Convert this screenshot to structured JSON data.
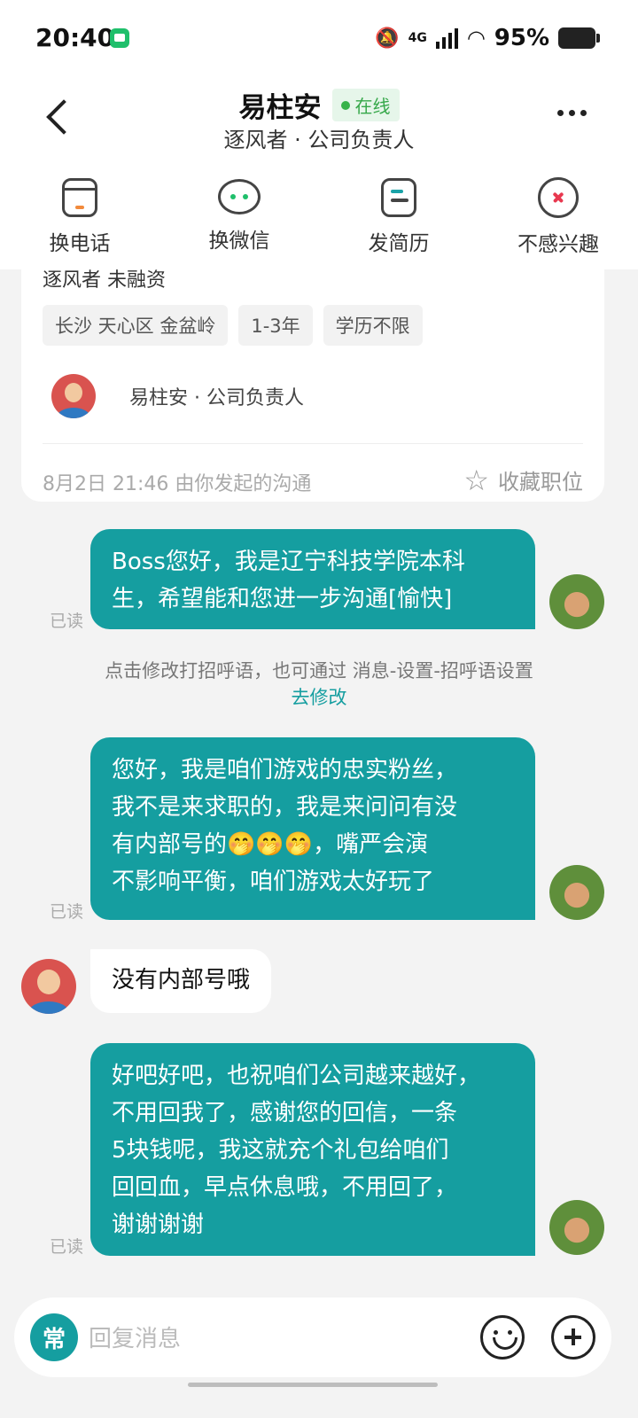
{
  "status_bar": {
    "time": "20:40",
    "battery_pct": "95%",
    "network": "4G"
  },
  "header": {
    "name": "易柱安",
    "online_label": "在线",
    "subtitle": "逐风者 · 公司负责人"
  },
  "actions": [
    {
      "label": "换电话",
      "icon": "phone-card-icon"
    },
    {
      "label": "换微信",
      "icon": "wechat-icon"
    },
    {
      "label": "发简历",
      "icon": "resume-icon"
    },
    {
      "label": "不感兴趣",
      "icon": "not-interested-icon"
    }
  ],
  "job_card": {
    "cut_text": "逐风者 未融资",
    "tags": [
      "长沙 天心区 金盆岭",
      "1-3年",
      "学历不限"
    ],
    "recruiter": "易柱安 · 公司负责人",
    "start_line": "8月2日 21:46 由你发起的沟通",
    "favorite_label": "收藏职位"
  },
  "messages": {
    "m1": {
      "line1": "Boss您好，我是辽宁科技学院本科",
      "line2": "生，希望能和您进一步沟通[愉快]",
      "read": "已读"
    },
    "system_note": {
      "text": "点击修改打招呼语，也可通过 消息-设置-招呼语设置",
      "link": "去修改"
    },
    "m2": {
      "line1": "您好，我是咱们游戏的忠实粉丝，",
      "line2": "我不是来求职的，我是来问问有没",
      "line3": "有内部号的🤭🤭🤭，嘴严会演",
      "line4": "不影响平衡，咱们游戏太好玩了",
      "read": "已读"
    },
    "m3": {
      "text": "没有内部号哦"
    },
    "m4": {
      "line1": "好吧好吧，也祝咱们公司越来越好，",
      "line2": "不用回我了，感谢您的回信，一条",
      "line3": "5块钱呢，我这就充个礼包给咱们",
      "line4": "回回血，早点休息哦，不用回了，",
      "line5": "谢谢谢谢",
      "read": "已读"
    }
  },
  "input_bar": {
    "quick_label": "常",
    "placeholder": "回复消息"
  },
  "colors": {
    "accent": "#159ea0",
    "online": "#38b34a"
  }
}
